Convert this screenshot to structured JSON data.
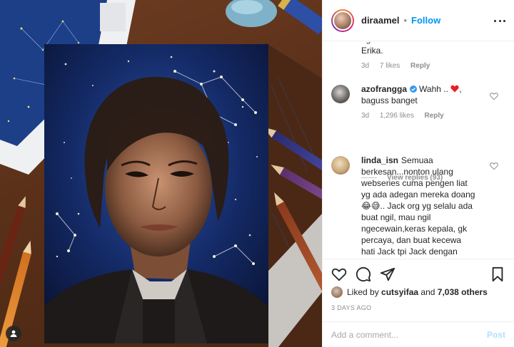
{
  "post": {
    "username": "diraamel",
    "separator": "•",
    "follow_label": "Follow",
    "more_icon": "more-options-icon"
  },
  "comments": [
    {
      "text": "ngelakuin kesalahan fatal ke Erika.",
      "time": "3d",
      "likes": "7 likes",
      "reply": "Reply"
    },
    {
      "user": "azofrangga",
      "verified": true,
      "text_before": "Wahh ..",
      "text_after": ", baguss banget",
      "emoji": "red-heart-icon",
      "time": "3d",
      "likes": "1,296 likes",
      "reply": "Reply",
      "view_replies": "View replies (93)"
    },
    {
      "user": "linda_isn",
      "text": "Semuaa berkesan...nonton ulang webseries cuma pengen liat yg ada adegan mereka doang😂😅.. Jack org yg selalu ada buat ngil, mau ngil ngecewain,keras kepala, gk percaya, dan buat kecewa hati Jack tpi Jack dengan tulusnya selalu ada buat ngil...ngeknyaa"
    }
  ],
  "liked": {
    "prefix": "Liked by",
    "user": "cutsyifaa",
    "and": "and",
    "others": "7,038 others"
  },
  "posted_ago": "3 DAYS AGO",
  "add_comment": {
    "placeholder": "Add a comment...",
    "post_label": "Post"
  },
  "colors": {
    "accent": "#0095f6",
    "post_disabled": "#b2dffc",
    "heart_red": "#ed4956"
  }
}
